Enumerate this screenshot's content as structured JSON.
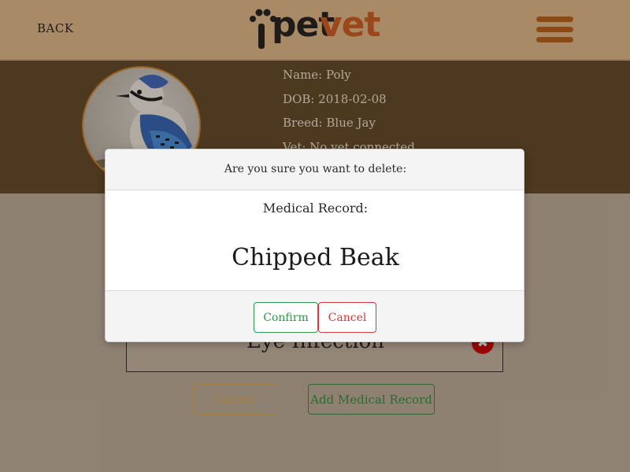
{
  "header": {
    "back_label": "BACK",
    "logo_pet": "pet",
    "logo_vet": "vet",
    "menu_icon": "hamburger-menu-icon",
    "colors": {
      "header_bg": "#dcb486",
      "logo_accent": "#c8581c",
      "menu": "#b35a12"
    }
  },
  "pet": {
    "name": "Name: Poly",
    "dob": "DOB: 2018-02-08",
    "breed": "Breed: Blue Jay",
    "vet": "Vet: No vet connected",
    "avatar_icon": "blue-jay-photo"
  },
  "records": {
    "items": [
      {
        "title": "Eye Infection"
      }
    ],
    "remove_icon": "delete-icon"
  },
  "actions": {
    "cancel_label": "Cancel",
    "add_label": "Add Medical Record"
  },
  "modal": {
    "question": "Are you sure you want to delete:",
    "record_label": "Medical Record:",
    "record_title": "Chipped Beak",
    "confirm_label": "Confirm",
    "cancel_label": "Cancel"
  }
}
